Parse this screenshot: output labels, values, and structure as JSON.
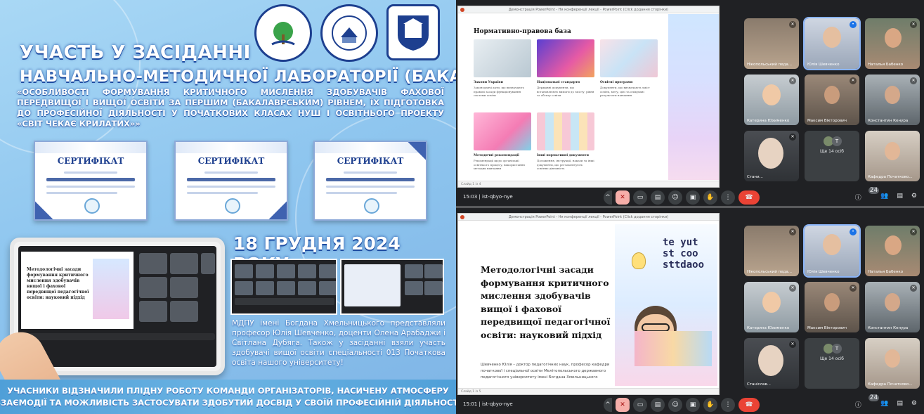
{
  "poster": {
    "title_line1": "УЧАСТЬ У ЗАСІДАННІ",
    "title_line2": "НАВЧАЛЬНО-МЕТОДИЧНОЇ ЛАБОРАТОРІЇ (БАКАЛАВРАТУ)",
    "subtitle": "«ОСОБЛИВОСТІ ФОРМУВАННЯ КРИТИЧНОГО МИСЛЕННЯ ЗДОБУВАЧІВ ФАХОВОЇ ПЕРЕДВИЩОЇ І ВИЩОЇ ОСВІТИ ЗА ПЕРШИМ (БАКАЛАВРСЬКИМ) РІВНЕМ, ЇХ ПІДГОТОВКА ДО ПРОФЕСІЙНОЇ ДІЯЛЬНОСТІ У ПОЧАТКОВИХ КЛАСАХ НУШ І ОСВІТНЬОГО ПРОЕКТУ «СВІТ ЧЕКАЄ КРИЛАТИХ»»",
    "certificates": [
      {
        "title": "СЕРТИФІКАТ"
      },
      {
        "title": "СЕРТИФІКАТ"
      },
      {
        "title": "СЕРТИФІКАТ"
      }
    ],
    "date": "18 ГРУДНЯ 2024 РОКУ",
    "note": "МДПУ імені Богдана Хмельницького представляли професор Юлія Шевченко, доценти Олена Арабаджи і Світлана Дубяга. Також у засіданні взяли участь здобувачі вищої освіти спеціальності 013 Початкова освіта нашого університету!",
    "footer_line1": "УЧАСНИКИ ВІДЗНАЧИЛИ ПЛІДНУ РОБОТУ КОМАНДИ ОРГАНІЗАТОРІВ, НАСИЧЕНУ АТМОСФЕРУ",
    "footer_line2": "ВЗАЄМОДІЇ ТА МОЖЛИВІСТЬ ЗАСТОСУВАТИ ЗДОБУТИЙ ДОСВІД У СВОЇЙ ПРОФЕСІЙНІЙ ДІЯЛЬНОСТІ"
  },
  "meet_top": {
    "window_title": "Демонстрація PowerPoint - Ня конференції лекції - PowerPoint (Сlick додання сторінки)",
    "slide_title": "Нормативно-правова база",
    "cards": [
      {
        "title": "Закони України",
        "desc": "Законодавчі акти, що визначають правові засади функціонування системи освіти"
      },
      {
        "title": "Національні стандарти",
        "desc": "Державні документи, що встановлюють вимоги до змісту, рівня та обсягу освіти"
      },
      {
        "title": "Освітні програми",
        "desc": "Документи, що визначають зміст освіти, мету, цілі та очікувані результати навчання"
      },
      {
        "title": "Методичні рекомендації",
        "desc": "Рекомендації щодо організації освітнього процесу, використання методик навчання"
      },
      {
        "title": "Інші нормативні документи",
        "desc": "Положення, інструкції, накази та інші документи, що регламентують освітню діяльність"
      }
    ],
    "status_left": "Слайд 1 із 4",
    "time": "15:03",
    "meeting_code": "ist-qbyo-nye",
    "participants_badge": "24",
    "tiles": [
      {
        "name": "Нікопольський педа..."
      },
      {
        "name": "Юлія Шевченко"
      },
      {
        "name": "Наталья Бабенко"
      },
      {
        "name": "Катерина Юхименко"
      },
      {
        "name": "Максим Вікторович"
      },
      {
        "name": "Константин Кенура"
      },
      {
        "name": "Стани..."
      },
      {
        "name": "Ще 14 осіб"
      },
      {
        "name": "Кафедра Початково..."
      }
    ]
  },
  "meet_bot": {
    "window_title": "Демонстрація PowerPoint - Ня конференції лекції - PowerPoint (Сlick додання сторінки)",
    "slide_title": "Методологічні засади формування критичного мислення здобувачів вищої і фахової передвищої педагогічної освіти: науковий підхід",
    "author": "Шевченко Юлія – доктор педагогічних наук, професор кафедри початкової і спеціальної освіти Мелітопольського державного педагогічного університету імені Богдана Хмельницького",
    "handwriting": "te yut st coo sttdaoo",
    "status_left": "Слайд 1 із 5",
    "time": "15:01",
    "meeting_code": "ist-qbyo-nye",
    "participants_badge": "24",
    "tiles": [
      {
        "name": "Нікопольський педа..."
      },
      {
        "name": "Юлія Шевченко"
      },
      {
        "name": "Наталья Бабенко"
      },
      {
        "name": "Катерина Юхименко"
      },
      {
        "name": "Максим Вікторович"
      },
      {
        "name": "Константин Кенура"
      },
      {
        "name": "Станіслав..."
      },
      {
        "name": "Ще 14 осіб"
      },
      {
        "name": "Кафедра Початково..."
      }
    ]
  },
  "colors": {
    "meet_bg": "#202124",
    "end_call": "#ea4335",
    "poster_bg": "#8fc6ef"
  }
}
